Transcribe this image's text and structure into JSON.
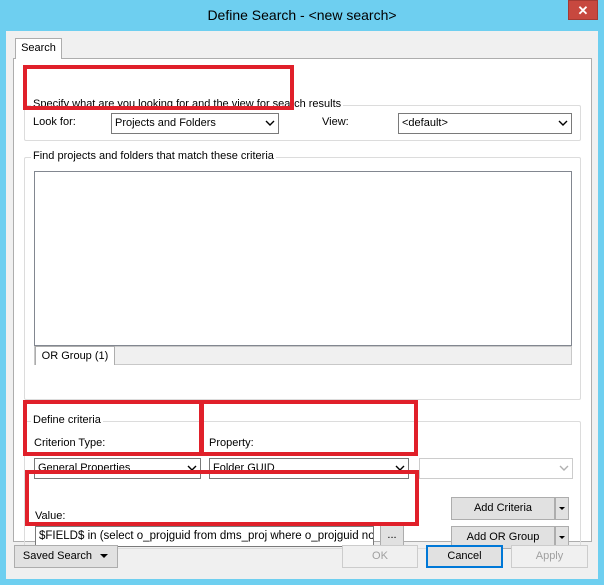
{
  "window": {
    "title": "Define Search - <new search>",
    "close_glyph": "✕"
  },
  "tabs": [
    {
      "label": "Search"
    }
  ],
  "spec_group": {
    "label": "Specify what are you looking for and the view for search results",
    "look_for_label": "Look for:",
    "look_for_value": "Projects and Folders",
    "view_label": "View:",
    "view_value": "<default>"
  },
  "find_group": {
    "label": "Find projects and folders that match these criteria",
    "or_group_tab": "OR Group (1)"
  },
  "criteria_group": {
    "label": "Define criteria",
    "criterion_type_label": "Criterion Type:",
    "criterion_type_value": "General Properties",
    "property_label": "Property:",
    "property_value": "Folder GUID",
    "operator_value": "",
    "value_label": "Value:",
    "value_text": "$FIELD$ in (select o_projguid from dms_proj where o_projguid not in",
    "browse_label": "...",
    "add_criteria_label": "Add Criteria",
    "add_or_group_label": "Add OR Group"
  },
  "footer": {
    "saved_search_label": "Saved Search",
    "ok_label": "OK",
    "cancel_label": "Cancel",
    "apply_label": "Apply"
  }
}
